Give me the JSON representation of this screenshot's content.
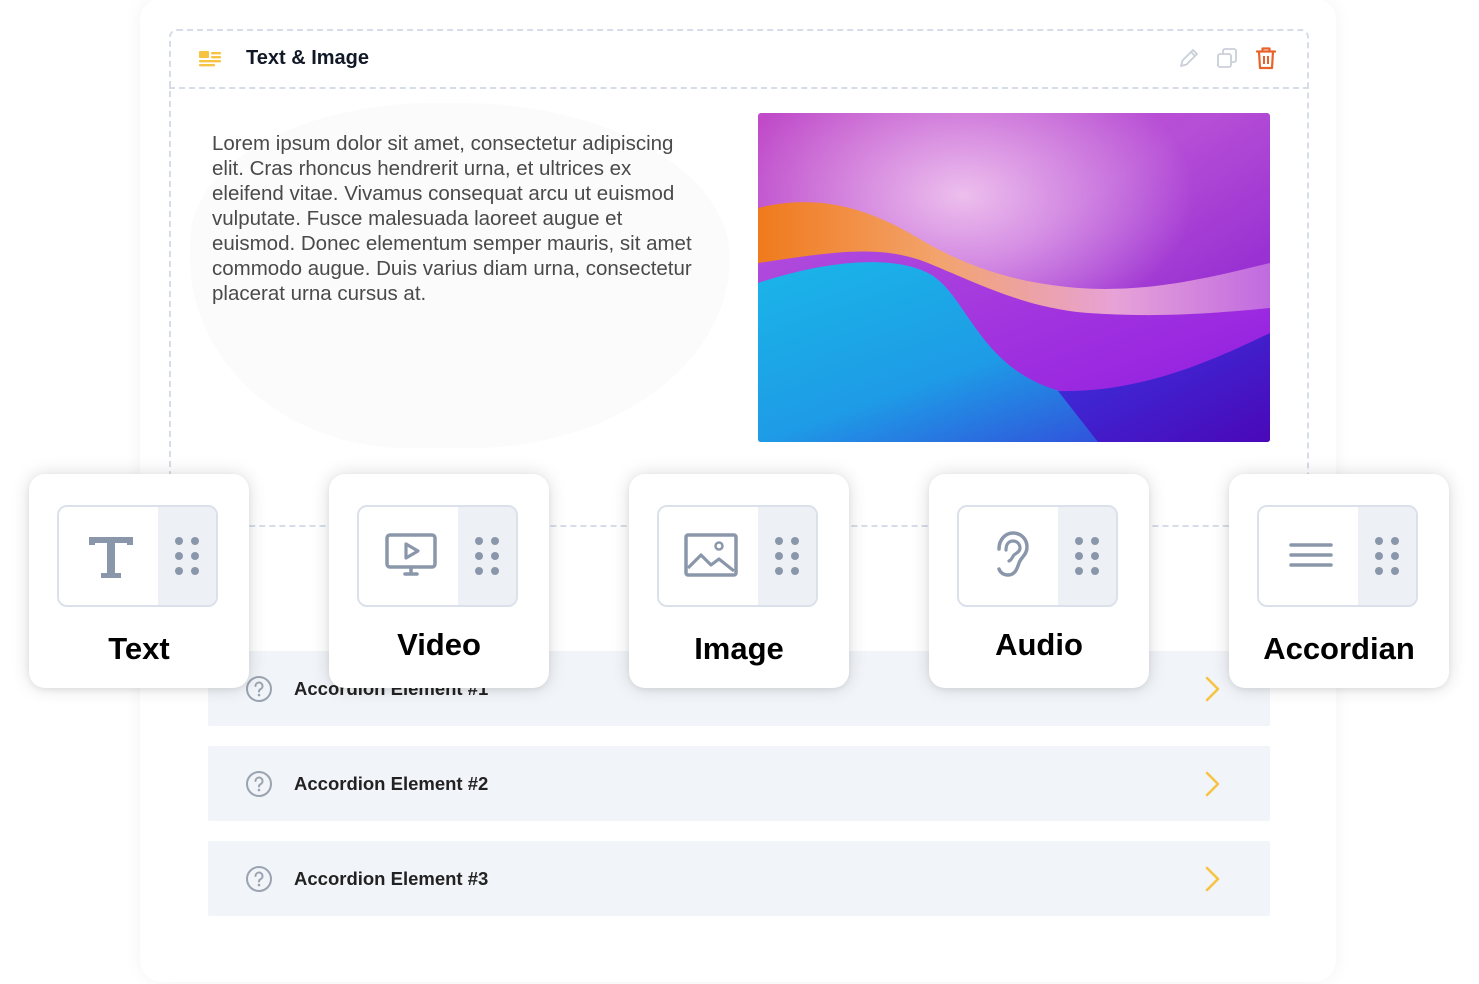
{
  "block": {
    "title": "Text & Image",
    "icons": {
      "type": "text-image-icon",
      "edit": "pencil-icon",
      "duplicate": "copy-icon",
      "delete": "trash-icon"
    },
    "body_text": "Lorem ipsum dolor sit amet, consectetur adipiscing elit. Cras rhoncus hendrerit urna, et ultrices ex eleifend vitae. Vivamus consequat arcu ut euismod vulputate. Fusce malesuada laoreet augue et euismod. Donec elementum semper mauris, sit amet commodo augue. Duis varius diam urna, consectetur placerat urna cursus at."
  },
  "accordion": [
    {
      "label": "Accordion Element #1",
      "icon": "question-circle-icon"
    },
    {
      "label": "Accordion Element #2",
      "icon": "question-circle-icon"
    },
    {
      "label": "Accordion Element #3",
      "icon": "question-circle-icon"
    }
  ],
  "elements": [
    {
      "label": "Text",
      "icon": "text-t-icon"
    },
    {
      "label": "Video",
      "icon": "video-icon"
    },
    {
      "label": "Image",
      "icon": "image-icon"
    },
    {
      "label": "Audio",
      "icon": "ear-icon"
    },
    {
      "label": "Accordian",
      "icon": "lines-icon"
    }
  ],
  "colors": {
    "accent_yellow": "#f6c343",
    "delete_orange": "#e8632b",
    "icon_gray": "#8a97ab",
    "row_bg": "#f1f4f8",
    "dash_border": "#d6dde8"
  }
}
